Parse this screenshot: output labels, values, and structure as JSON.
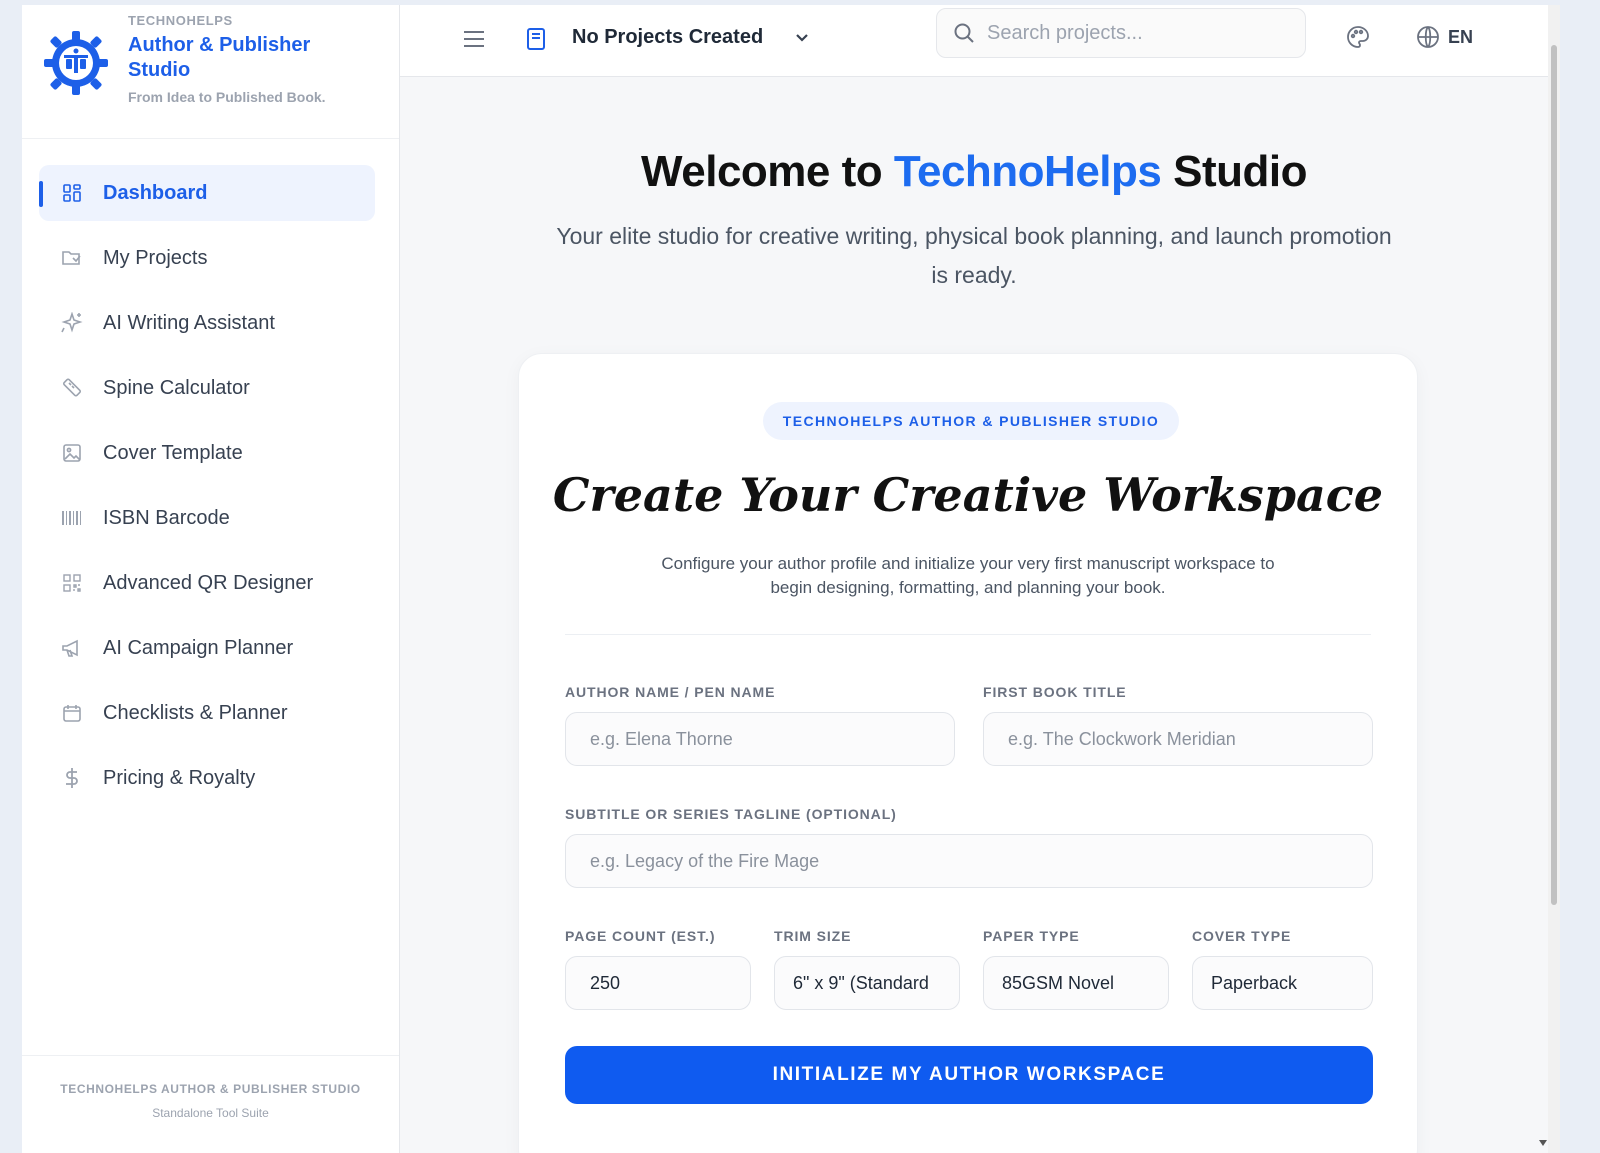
{
  "brand": {
    "kicker": "TECHNOHELPS",
    "title": "Author & Publisher Studio",
    "tagline": "From Idea to Published Book.",
    "logo_icon": "gear-logo-icon",
    "accent_color": "#1d5fe8"
  },
  "sidebar": {
    "items": [
      {
        "label": "Dashboard",
        "icon": "dashboard-grid-icon",
        "active": true
      },
      {
        "label": "My Projects",
        "icon": "projects-icon",
        "active": false
      },
      {
        "label": "AI Writing Assistant",
        "icon": "sparkle-icon",
        "active": false
      },
      {
        "label": "Spine Calculator",
        "icon": "ruler-icon",
        "active": false
      },
      {
        "label": "Cover Template",
        "icon": "image-icon",
        "active": false
      },
      {
        "label": "ISBN Barcode",
        "icon": "barcode-icon",
        "active": false
      },
      {
        "label": "Advanced QR Designer",
        "icon": "qr-icon",
        "active": false
      },
      {
        "label": "AI Campaign Planner",
        "icon": "megaphone-icon",
        "active": false
      },
      {
        "label": "Checklists & Planner",
        "icon": "calendar-icon",
        "active": false
      },
      {
        "label": "Pricing & Royalty",
        "icon": "dollar-icon",
        "active": false
      }
    ],
    "footer_title": "TECHNOHELPS AUTHOR & PUBLISHER STUDIO",
    "footer_sub": "Standalone Tool Suite"
  },
  "topbar": {
    "project_selector": "No Projects Created",
    "search_placeholder": "Search projects...",
    "language": "EN"
  },
  "hero": {
    "title_prefix": "Welcome to ",
    "title_accent": "TechnoHelps",
    "title_suffix": " Studio",
    "subtitle": "Your elite studio for creative writing, physical book planning, and launch promotion is ready."
  },
  "card": {
    "pill": "TECHNOHELPS AUTHOR & PUBLISHER STUDIO",
    "title": "Create Your Creative Workspace",
    "description": "Configure your author profile and initialize your very first manuscript workspace to begin designing, formatting, and planning your book.",
    "fields": {
      "author_label": "AUTHOR NAME / PEN NAME",
      "author_placeholder": "e.g. Elena Thorne",
      "book_label": "FIRST BOOK TITLE",
      "book_placeholder": "e.g. The Clockwork Meridian",
      "subtitle_label": "SUBTITLE OR SERIES TAGLINE (OPTIONAL)",
      "subtitle_placeholder": "e.g. Legacy of the Fire Mage",
      "page_count_label": "PAGE COUNT (EST.)",
      "page_count_value": "250",
      "trim_label": "TRIM SIZE",
      "trim_value": "6\" x 9\" (Standard",
      "paper_label": "PAPER TYPE",
      "paper_value": "85GSM Novel",
      "cover_label": "COVER TYPE",
      "cover_value": "Paperback"
    },
    "cta": "INITIALIZE MY AUTHOR WORKSPACE"
  }
}
